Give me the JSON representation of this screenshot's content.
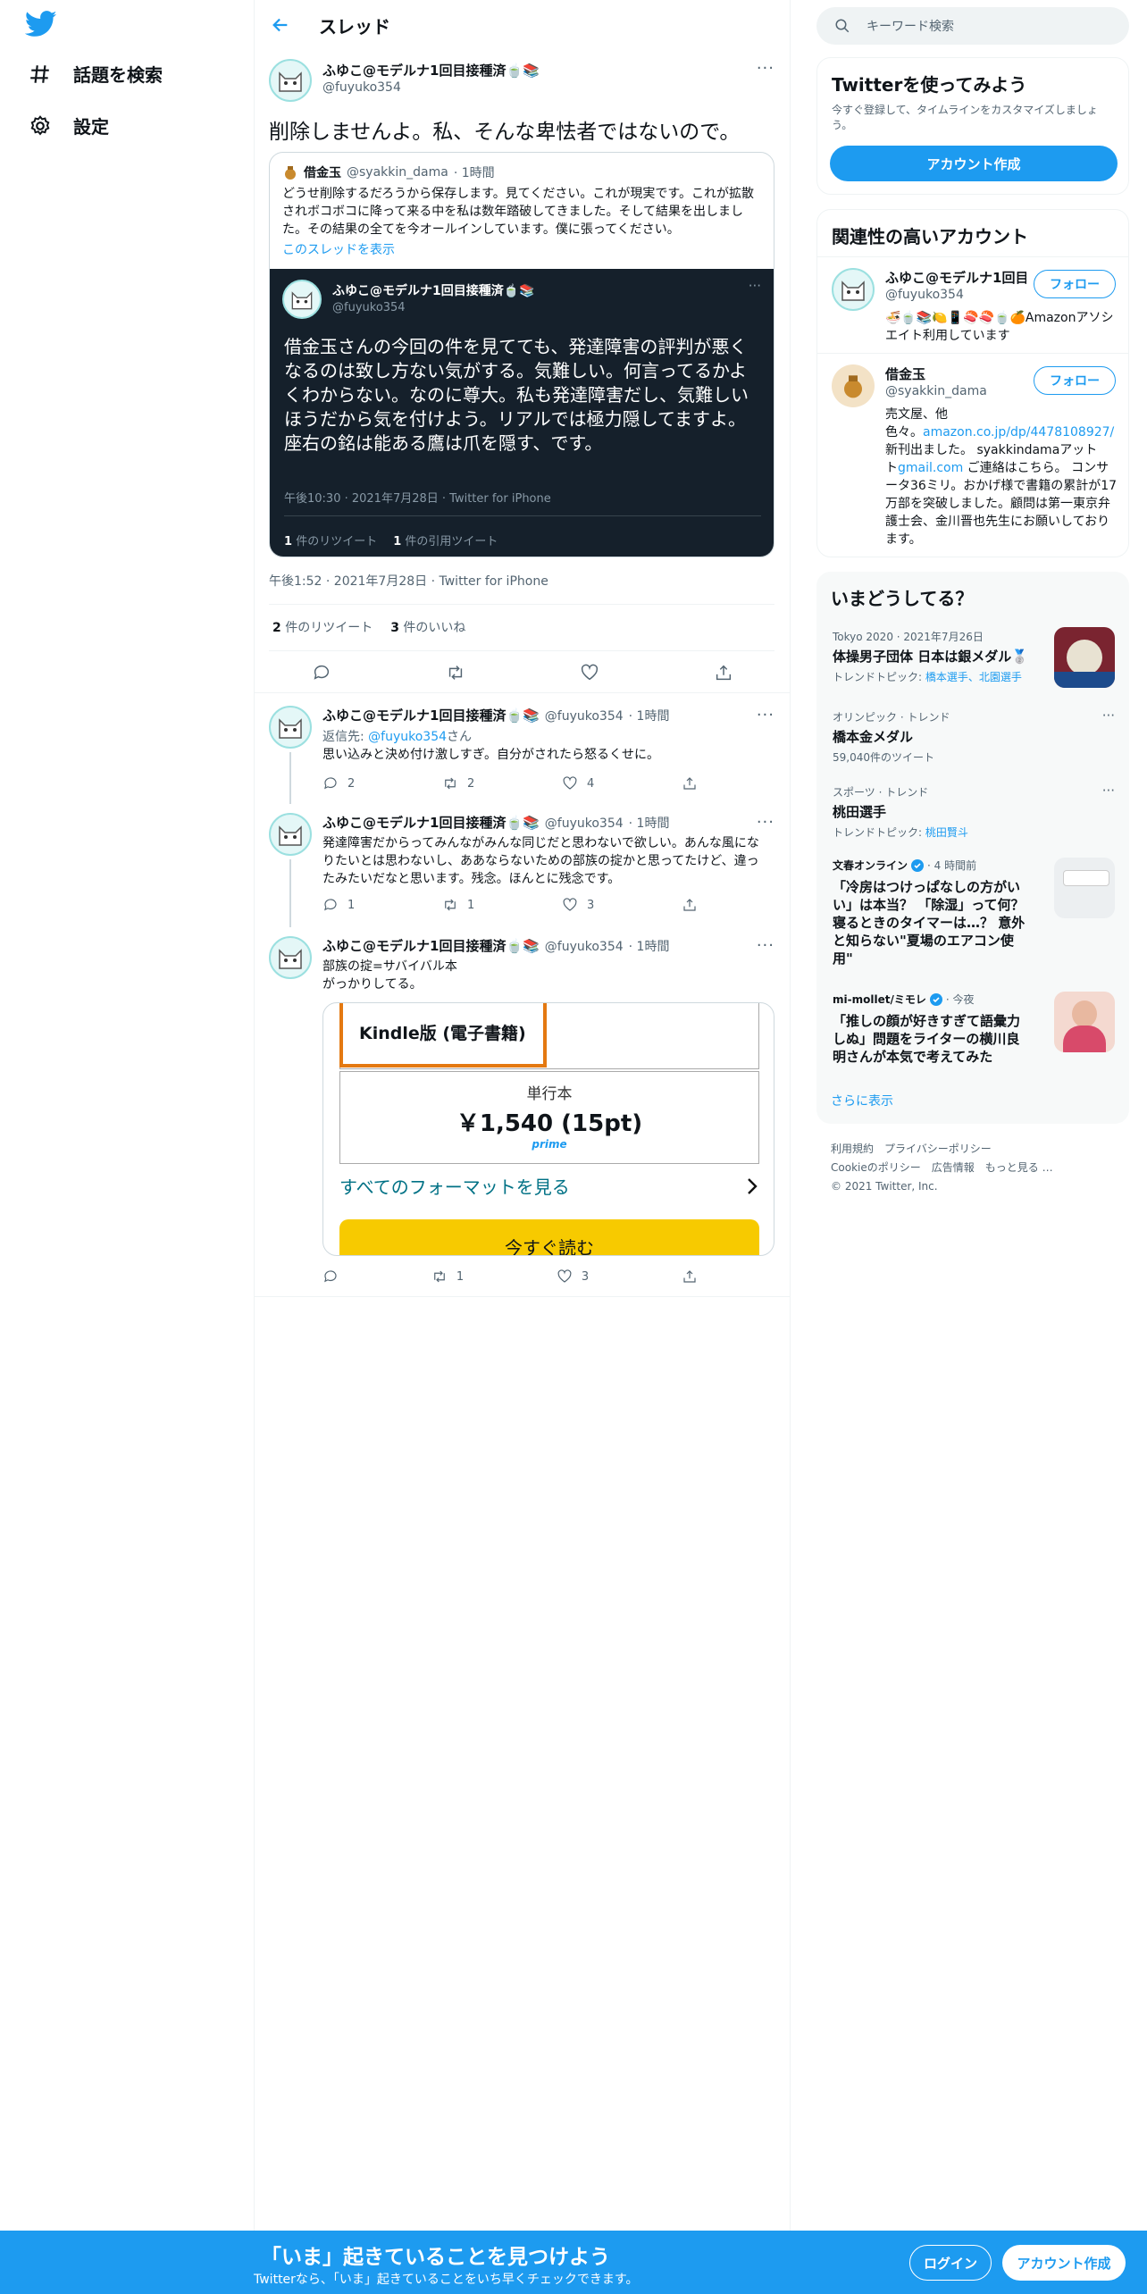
{
  "sidebar": {
    "items": [
      {
        "label": "話題を検索",
        "icon": "hashtag-icon"
      },
      {
        "label": "設定",
        "icon": "gear-icon"
      }
    ]
  },
  "header": {
    "title": "スレッド"
  },
  "main_tweet": {
    "name": "ふゆこ@モデルナ1回目接種済🍵📚",
    "handle": "@fuyuko354",
    "text": "削除しませんよ。私、そんな卑怯者ではないので。",
    "quote": {
      "name": "借金玉",
      "handle": "@syakkin_dama",
      "time": "· 1時間",
      "text": "どうせ削除するだろうから保存します。見てください。これが現実です。これが拡散されボコボコに降って来る中を私は数年踏破してきました。そして結果を出しました。その結果の全てを今オールインしています。僕に張ってください。",
      "show_thread": "このスレッドを表示",
      "screenshot": {
        "name": "ふゆこ@モデルナ1回目接種済🍵📚",
        "handle": "@fuyuko354",
        "text": "借金玉さんの今回の件を見てても、発達障害の評判が悪くなるのは致し方ない気がする。気難しい。何言ってるかよくわからない。なのに尊大。私も発達障害だし、気難しいほうだから気を付けよう。リアルでは極力隠してますよ。座右の銘は能ある鷹は爪を隠す、です。",
        "meta": "午後10:30 · 2021年7月28日 · Twitter for iPhone",
        "rt_count": "1",
        "rt_label": "件のリツイート",
        "qt_count": "1",
        "qt_label": "件の引用ツイート"
      }
    },
    "meta": "午後1:52 · 2021年7月28日 · Twitter for iPhone",
    "retweets": "2",
    "retweets_label": "件のリツイート",
    "likes": "3",
    "likes_label": "件のいいね"
  },
  "replies": [
    {
      "name": "ふゆこ@モデルナ1回目接種済🍵📚",
      "handle": "@fuyuko354",
      "time": "· 1時間",
      "reply_to_label": "返信先: ",
      "reply_to_handle": "@fuyuko354",
      "reply_to_suffix": "さん",
      "text": "思い込みと決め付け激しすぎ。自分がされたら怒るくせに。",
      "replies": "2",
      "retweets": "2",
      "likes": "4"
    },
    {
      "name": "ふゆこ@モデルナ1回目接種済🍵📚",
      "handle": "@fuyuko354",
      "time": "· 1時間",
      "text": "発達障害だからってみんながみんな同じだと思わないで欲しい。あんな風になりたいとは思わないし、ああならないための部族の掟かと思ってたけど、違ったみたいだなと思います。残念。ほんとに残念です。",
      "replies": "1",
      "retweets": "1",
      "likes": "3"
    },
    {
      "name": "ふゆこ@モデルナ1回目接種済🍵📚",
      "handle": "@fuyuko354",
      "time": "· 1時間",
      "text1": "部族の掟=サバイバル本",
      "text2": "がっかりしてる。",
      "kindle": {
        "kindle_label": "Kindle版 (電子書籍)",
        "format": "単行本",
        "price": "￥1,540 (15pt)",
        "prime": "prime",
        "all_formats": "すべてのフォーマットを見る",
        "read_now": "今すぐ読む"
      },
      "retweets": "1",
      "likes": "3"
    }
  ],
  "search": {
    "placeholder": "キーワード検索"
  },
  "signup": {
    "title": "Twitterを使ってみよう",
    "desc": "今すぐ登録して、タイムラインをカスタマイズしましょう。",
    "button": "アカウント作成"
  },
  "related": {
    "title": "関連性の高いアカウント",
    "follow": "フォロー",
    "accounts": [
      {
        "name": "ふゆこ@モデルナ1回目",
        "handle": "@fuyuko354",
        "bio": "🍜🍵📚🍋📱🍣🍣🍵🍊Amazonアソシエイト利用しています"
      },
      {
        "name": "借金玉",
        "handle": "@syakkin_dama",
        "bio1": "売文屋、他",
        "bio2": "色々。",
        "bio3": "新刊出ました。 ",
        "bio_link": "amazon.co.jp/dp/4478108927/",
        "bio4": " syakkindamaアット",
        "bio_link2": "gmail.com",
        "bio5": " ご連絡はこちら。 コンサータ36ミリ。おかげ様で書籍の累計が17万部を突破しました。顧問は第一東京弁護士会、金川晋也先生にお願いしております。"
      }
    ]
  },
  "trends": {
    "title": "いまどうしてる？",
    "items": [
      {
        "meta": "Tokyo 2020 · 2021年7月26日",
        "title": "体操男子団体 日本は銀メダル🥈",
        "topic_label": "トレンドトピック: ",
        "topic": "橋本選手、北園選手"
      },
      {
        "meta": "オリンピック · トレンド",
        "title": "橋本金メダル",
        "count": "59,040件のツイート"
      },
      {
        "meta": "スポーツ · トレンド",
        "title": "桃田選手",
        "topic_label": "トレンドトピック: ",
        "topic": "桃田賢斗"
      },
      {
        "source": "文春オンライン",
        "time": "· 4 時間前",
        "title": "「冷房はつけっぱなしの方がいい」は本当？ 「除湿」って何？ 寝るときのタイマーは…？ 意外と知らない\"夏場のエアコン使用\""
      },
      {
        "source": "mi-mollet/ミモレ",
        "time": "· 今夜",
        "title": "「推しの顔が好きすぎて語彙力しぬ」問題をライターの横川良明さんが本気で考えてみた"
      }
    ],
    "more": "さらに表示"
  },
  "footer": {
    "links1": [
      "利用規約",
      "プライバシーポリシー"
    ],
    "links2": [
      "Cookieのポリシー",
      "広告情報",
      "もっと見る …"
    ],
    "copyright": "© 2021 Twitter, Inc."
  },
  "bottom_bar": {
    "title": "「いま」起きていることを見つけよう",
    "subtitle": "Twitterなら、「いま」起きていることをいち早くチェックできます。",
    "login": "ログイン",
    "signup": "アカウント作成"
  },
  "colors": {
    "accent": "#1d9bf0",
    "dark_card": "#15202b",
    "kindle_button": "#f7ca00",
    "kindle_border": "#e47911"
  }
}
